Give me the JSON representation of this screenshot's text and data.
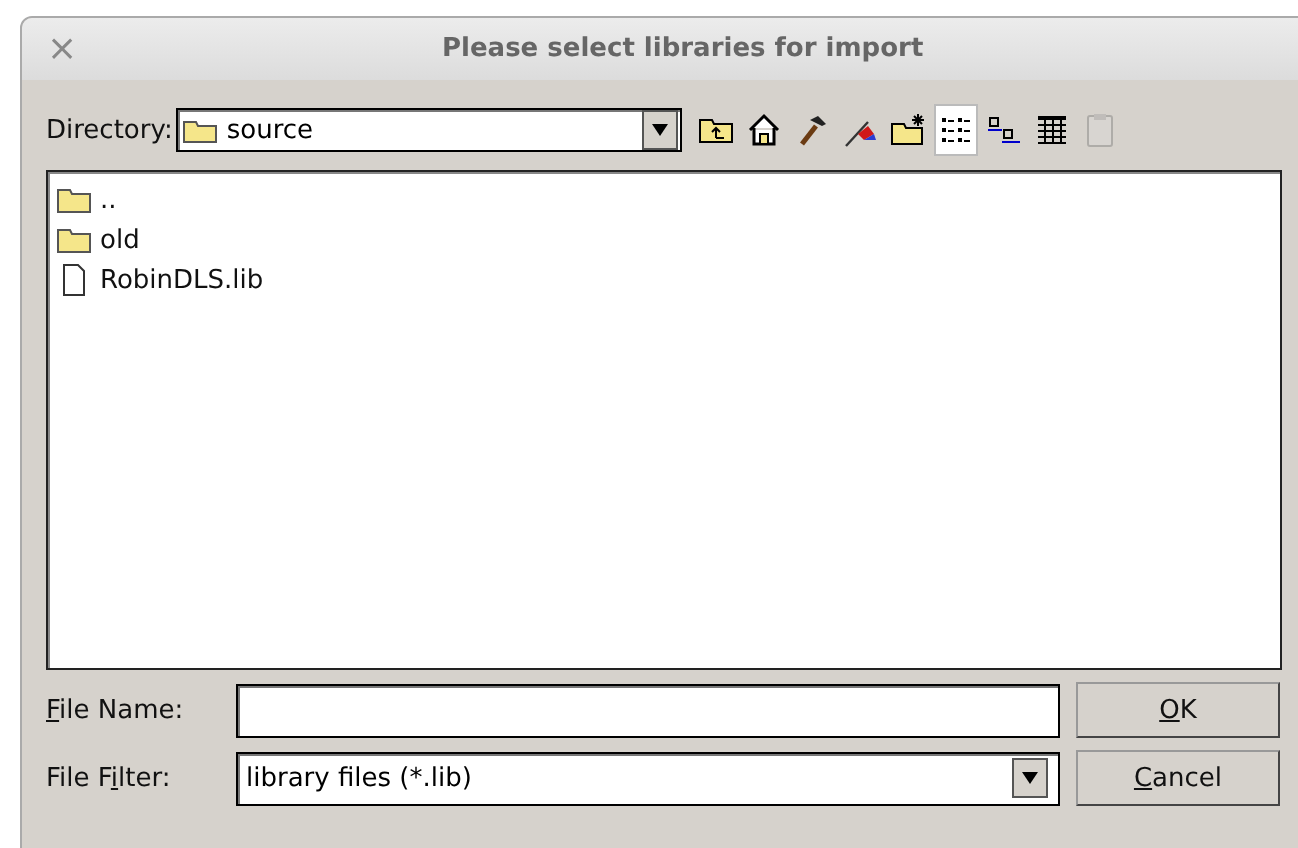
{
  "window": {
    "title": "Please select libraries for import",
    "close": "×"
  },
  "directory": {
    "label": "Directory:",
    "value": "source"
  },
  "toolbar": [
    {
      "kind": "up-folder",
      "selected": false,
      "disabled": false
    },
    {
      "kind": "home",
      "selected": false,
      "disabled": false
    },
    {
      "kind": "hammer",
      "selected": false,
      "disabled": false
    },
    {
      "kind": "pen",
      "selected": false,
      "disabled": false
    },
    {
      "kind": "new-folder",
      "selected": false,
      "disabled": false
    },
    {
      "kind": "list-view",
      "selected": true,
      "disabled": false
    },
    {
      "kind": "icon-view",
      "selected": false,
      "disabled": false
    },
    {
      "kind": "detail-view",
      "selected": false,
      "disabled": false
    },
    {
      "kind": "clipboard",
      "selected": false,
      "disabled": true
    }
  ],
  "files": [
    {
      "kind": "folder",
      "name": ".."
    },
    {
      "kind": "folder",
      "name": "old"
    },
    {
      "kind": "file",
      "name": "RobinDLS.lib"
    }
  ],
  "file_name": {
    "mnemonic": "F",
    "label_after": "ile Name:"
  },
  "file_filter": {
    "label_before": "File F",
    "mnemonic": "i",
    "label_after": "lter:",
    "value": "library files (*.lib)"
  },
  "buttons": [
    {
      "mnemonic": "O",
      "label_after": "K"
    },
    {
      "mnemonic": "C",
      "label_after": "ancel"
    }
  ]
}
